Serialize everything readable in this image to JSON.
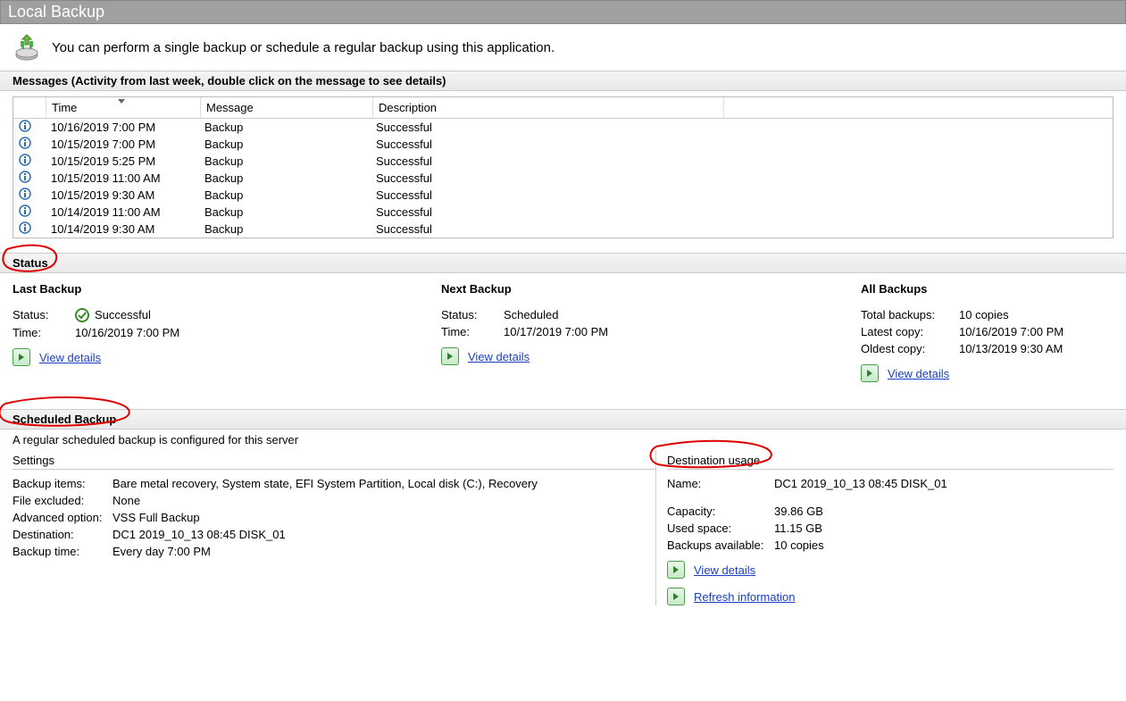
{
  "title": "Local Backup",
  "intro": "You can perform a single backup or schedule a regular backup using this application.",
  "messages_header": "Messages  (Activity from last week, double click on the message to see details)",
  "grid": {
    "cols": {
      "time": "Time",
      "message": "Message",
      "description": "Description"
    },
    "rows": [
      {
        "time": "10/16/2019 7:00 PM",
        "msg": "Backup",
        "desc": "Successful"
      },
      {
        "time": "10/15/2019 7:00 PM",
        "msg": "Backup",
        "desc": "Successful"
      },
      {
        "time": "10/15/2019 5:25 PM",
        "msg": "Backup",
        "desc": "Successful"
      },
      {
        "time": "10/15/2019 11:00 AM",
        "msg": "Backup",
        "desc": "Successful"
      },
      {
        "time": "10/15/2019 9:30 AM",
        "msg": "Backup",
        "desc": "Successful"
      },
      {
        "time": "10/14/2019 11:00 AM",
        "msg": "Backup",
        "desc": "Successful"
      },
      {
        "time": "10/14/2019 9:30 AM",
        "msg": "Backup",
        "desc": "Successful"
      }
    ]
  },
  "status_header": "Status",
  "status": {
    "last": {
      "title": "Last Backup",
      "status_label": "Status:",
      "status_value": "Successful",
      "time_label": "Time:",
      "time_value": "10/16/2019 7:00 PM",
      "link": "View details"
    },
    "next": {
      "title": "Next Backup",
      "status_label": "Status:",
      "status_value": "Scheduled",
      "time_label": "Time:",
      "time_value": "10/17/2019 7:00 PM",
      "link": "View details"
    },
    "all": {
      "title": "All Backups",
      "total_label": "Total backups:",
      "total_value": "10 copies",
      "latest_label": "Latest copy:",
      "latest_value": "10/16/2019 7:00 PM",
      "oldest_label": "Oldest copy:",
      "oldest_value": "10/13/2019 9:30 AM",
      "link": "View details"
    }
  },
  "sched_header": "Scheduled Backup",
  "sched_desc": "A regular scheduled backup is configured for this server",
  "settings": {
    "title": "Settings",
    "items_label": "Backup items:",
    "items_value": "Bare metal recovery, System state, EFI System Partition, Local disk (C:), Recovery",
    "excl_label": "File excluded:",
    "excl_value": "None",
    "adv_label": "Advanced option:",
    "adv_value": "VSS Full Backup",
    "dest_label": "Destination:",
    "dest_value": "DC1 2019_10_13 08:45 DISK_01",
    "time_label": "Backup time:",
    "time_value": "Every day 7:00 PM"
  },
  "dest": {
    "title": "Destination usage",
    "name_label": "Name:",
    "name_value": "DC1 2019_10_13 08:45 DISK_01",
    "cap_label": "Capacity:",
    "cap_value": "39.86 GB",
    "used_label": "Used space:",
    "used_value": "11.15 GB",
    "avail_label": "Backups available:",
    "avail_value": "10 copies",
    "link1": "View details",
    "link2": "Refresh information"
  }
}
